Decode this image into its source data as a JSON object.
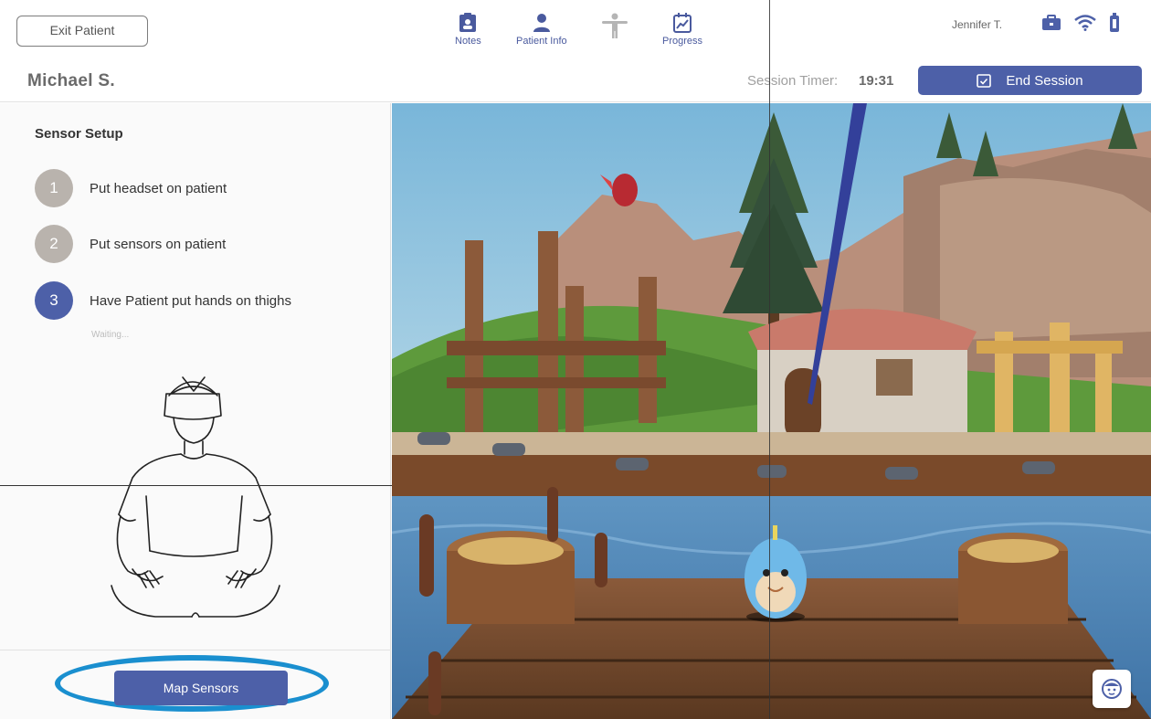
{
  "header": {
    "exit_label": "Exit Patient",
    "patient_name": "Michael S.",
    "user_name": "Jennifer T.",
    "timer_label": "Session Timer:",
    "timer_value": "19:31",
    "end_session_label": "End Session",
    "nav": [
      {
        "label": "Notes",
        "icon": "notes-icon"
      },
      {
        "label": "Patient Info",
        "icon": "person-icon"
      },
      {
        "label": "",
        "icon": "body-figure-icon"
      },
      {
        "label": "Progress",
        "icon": "progress-icon"
      }
    ],
    "status_icons": [
      "briefcase-icon",
      "wifi-icon",
      "battery-icon"
    ]
  },
  "sensor_setup": {
    "title": "Sensor Setup",
    "steps": [
      {
        "number": "1",
        "text": "Put headset on patient"
      },
      {
        "number": "2",
        "text": "Put sensors on patient"
      },
      {
        "number": "3",
        "text": "Have Patient put hands on thighs"
      }
    ],
    "status": "Waiting...",
    "map_button": "Map Sensors"
  },
  "colors": {
    "primary": "#4d60a8",
    "highlight_ring": "#1a8fcf",
    "step_inactive": "#b9b3ad"
  }
}
